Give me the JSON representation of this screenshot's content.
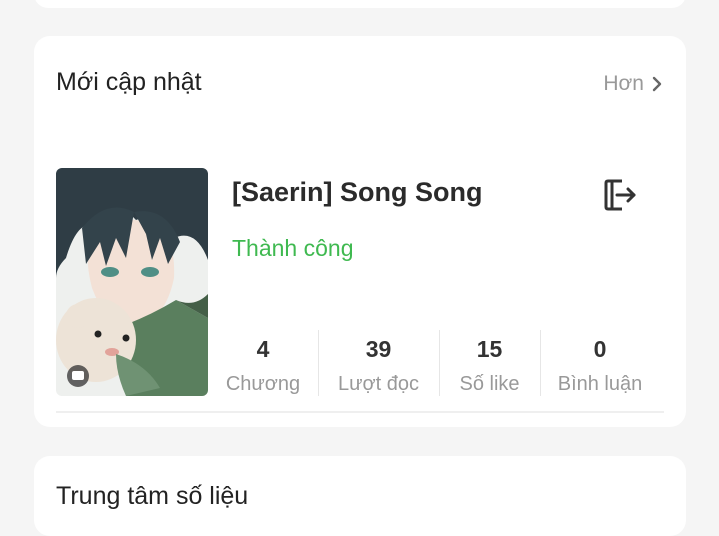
{
  "recent": {
    "title": "Mới cập nhật",
    "more_label": "Hơn",
    "book": {
      "title": "[Saerin] Song Song",
      "status": "Thành công",
      "status_color": "#3fb950",
      "stats": [
        {
          "value": "4",
          "label": "Chương"
        },
        {
          "value": "39",
          "label": "Lượt đọc"
        },
        {
          "value": "15",
          "label": "Số like"
        },
        {
          "value": "0",
          "label": "Bình luận"
        }
      ]
    }
  },
  "data_center": {
    "title": "Trung tâm số liệu"
  }
}
